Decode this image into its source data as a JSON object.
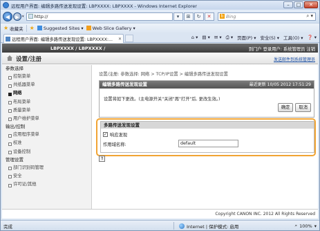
{
  "window": {
    "title": "远程用户界面: 编辑多路传送发现设置: LBPXXXX: LBPXXXX - Windows Internet Explorer",
    "min": "–",
    "max": "□",
    "close": "✕"
  },
  "browser": {
    "address": "http://",
    "search_placeholder": "Bing",
    "favorites_label": "收藏夹",
    "fav_items": [
      "Suggested Sites ▾",
      "Web Slice Gallery ▾"
    ],
    "tab_title": "远程用户界面: 编辑多路传送发现设置: LBPXXXX:...",
    "commands": [
      "页面(P) ▾",
      "安全(S) ▾",
      "工具(O) ▾",
      "❓ ▾"
    ],
    "status_done": "完成",
    "status_zone": "Internet | 保护模式: 启用",
    "zoom": "100%"
  },
  "header": {
    "model": "LBPXXXX / LBPXXXX /",
    "links": "到门户  登录用户: 系统管理员  注销",
    "title": "设置/注册",
    "mail_link": "发送邮件到系统管理员"
  },
  "sidebar": {
    "groups": [
      {
        "label": "参数选择",
        "items": [
          {
            "label": "控制菜单",
            "active": false
          },
          {
            "label": "共纸器菜单",
            "active": false
          },
          {
            "label": "网络",
            "active": true
          },
          {
            "label": "布局菜单",
            "active": false
          },
          {
            "label": "质量菜单",
            "active": false
          },
          {
            "label": "用户维护菜单",
            "active": false
          }
        ]
      },
      {
        "label": "输出/控制",
        "items": [
          {
            "label": "应用程序菜单",
            "active": false
          },
          {
            "label": "校准",
            "active": false
          },
          {
            "label": "设备控制",
            "active": false
          }
        ]
      },
      {
        "label": "管理设置",
        "items": [
          {
            "label": "部门识别码管理",
            "active": false
          },
          {
            "label": "安全",
            "active": false
          },
          {
            "label": "许可证/其他",
            "active": false
          }
        ]
      }
    ]
  },
  "content": {
    "breadcrumb": "设置/注册: 参数选择: 网络 > TCP/IP设置 > 编辑多路传送发现设置",
    "panel_title": "编辑多路传送发现设置",
    "last_updated": "最近更新 10/05 2012 17:51:29",
    "note": "设置将如下更改。(主电源开关\"关闭\"再\"打开\"后, 更改生效。)",
    "ok_button": "确定",
    "cancel_button": "取消",
    "section_title": "多路传送发现设置",
    "respond_label": "响应发现",
    "respond_checked": "✓",
    "scope_label": "作用域名称:",
    "scope_value": "default",
    "top_icon": "⇑",
    "copyright": "Copyright CANON INC. 2012 All Rights Reserved"
  }
}
